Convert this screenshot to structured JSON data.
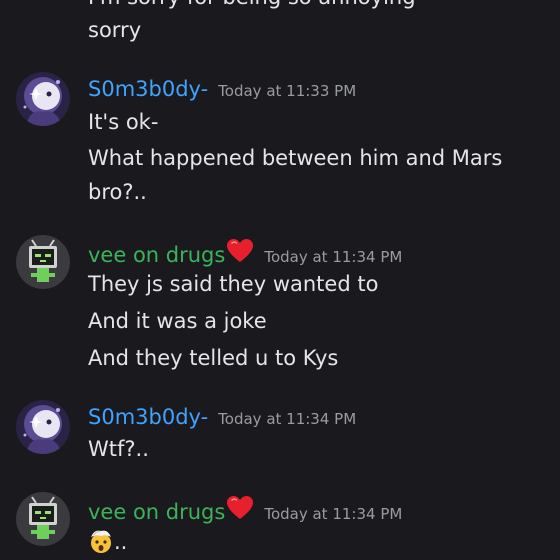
{
  "colors": {
    "background": "#1a1a1e",
    "text": "#e3e5e8",
    "timestamp": "#9a9ca3",
    "user_blue": "#3fa3ff",
    "user_green": "#3bb35a",
    "heart": "#e8202e"
  },
  "messages": {
    "prev_tail": {
      "cut_line": "I'm sorry for being so annoying",
      "text": "sorry"
    },
    "m1": {
      "username": "S0m3b0dy-",
      "timestamp": "Today at 11:33 PM",
      "lines": [
        "It's ok-",
        "What happened between him and Mars",
        "bro?.."
      ]
    },
    "m2": {
      "username": "vee on drugs",
      "username_icon": "red-heart-icon",
      "timestamp": "Today at 11:34 PM",
      "lines": [
        "They js said they wanted to",
        "And it was a joke",
        "And they telled u to Kys"
      ]
    },
    "m3": {
      "username": "S0m3b0dy-",
      "timestamp": "Today at 11:34 PM",
      "lines": [
        "Wtf?.."
      ]
    },
    "m4": {
      "username": "vee on drugs",
      "username_icon": "red-heart-icon",
      "timestamp": "Today at 11:34 PM",
      "emoji": "exploding-head-emoji",
      "text_after_emoji": ".."
    }
  }
}
